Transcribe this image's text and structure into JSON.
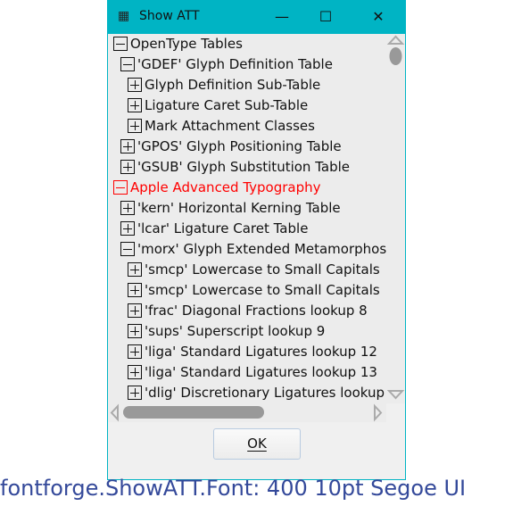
{
  "window": {
    "title": "Show ATT",
    "icon": "fontforge-icon",
    "controls": {
      "minimize": "—",
      "maximize": "☐",
      "close": "✕"
    }
  },
  "tree": [
    {
      "level": 0,
      "expanded": true,
      "label": "OpenType Tables",
      "color": "#111111"
    },
    {
      "level": 1,
      "expanded": true,
      "label": "'GDEF' Glyph Definition Table"
    },
    {
      "level": 2,
      "expanded": false,
      "label": "Glyph Definition Sub-Table"
    },
    {
      "level": 2,
      "expanded": false,
      "label": "Ligature Caret Sub-Table"
    },
    {
      "level": 2,
      "expanded": false,
      "label": "Mark Attachment Classes"
    },
    {
      "level": 1,
      "expanded": false,
      "label": "'GPOS' Glyph Positioning Table"
    },
    {
      "level": 1,
      "expanded": false,
      "label": "'GSUB' Glyph Substitution Table"
    },
    {
      "level": 0,
      "expanded": true,
      "label": "Apple Advanced Typography",
      "color": "#ff0000"
    },
    {
      "level": 1,
      "expanded": false,
      "label": "'kern' Horizontal Kerning Table"
    },
    {
      "level": 1,
      "expanded": false,
      "label": "'lcar' Ligature Caret Table"
    },
    {
      "level": 1,
      "expanded": true,
      "label": "'morx' Glyph Extended Metamorphosis"
    },
    {
      "level": 2,
      "expanded": false,
      "label": "'smcp' Lowercase to Small Capitals"
    },
    {
      "level": 2,
      "expanded": false,
      "label": "'smcp' Lowercase to Small Capitals"
    },
    {
      "level": 2,
      "expanded": false,
      "label": "'frac' Diagonal Fractions lookup 8"
    },
    {
      "level": 2,
      "expanded": false,
      "label": "'sups' Superscript lookup 9"
    },
    {
      "level": 2,
      "expanded": false,
      "label": "'liga' Standard Ligatures lookup 12"
    },
    {
      "level": 2,
      "expanded": false,
      "label": "'liga' Standard Ligatures lookup 13"
    },
    {
      "level": 2,
      "expanded": false,
      "label": "'dlig' Discretionary Ligatures lookup"
    }
  ],
  "ok_button": {
    "label": "OK",
    "mnemonic": "O"
  },
  "caption": "fontforge.ShowATT.Font: 400 10pt Segoe UI"
}
